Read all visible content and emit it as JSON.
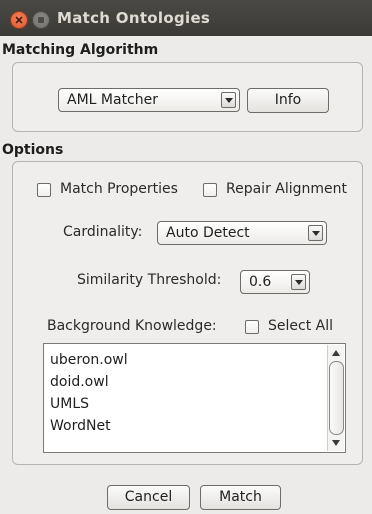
{
  "window": {
    "title": "Match Ontologies"
  },
  "algorithm_section": {
    "heading": "Matching Algorithm",
    "matcher_select": {
      "value": "AML Matcher"
    },
    "info_button": "Info"
  },
  "options_section": {
    "heading": "Options",
    "match_properties": {
      "label": "Match Properties",
      "checked": false
    },
    "repair_alignment": {
      "label": "Repair Alignment",
      "checked": false
    },
    "cardinality": {
      "label": "Cardinality:",
      "value": "Auto Detect"
    },
    "similarity_threshold": {
      "label": "Similarity Threshold:",
      "value": "0.6"
    },
    "background_knowledge": {
      "label": "Background Knowledge:",
      "select_all": {
        "label": "Select All",
        "checked": false
      },
      "items": [
        "uberon.owl",
        "doid.owl",
        "UMLS",
        "WordNet"
      ]
    }
  },
  "footer": {
    "cancel_button": "Cancel",
    "match_button": "Match"
  },
  "icons": {
    "close": "close-icon",
    "minimize": "minimize-icon",
    "dropdown": "chevron-down-icon",
    "scroll_up": "arrow-up-icon",
    "scroll_down": "arrow-down-icon"
  },
  "colors": {
    "titlebar": "#3f3e3a",
    "close_button": "#e9683f",
    "window_bg": "#ecebe9"
  }
}
